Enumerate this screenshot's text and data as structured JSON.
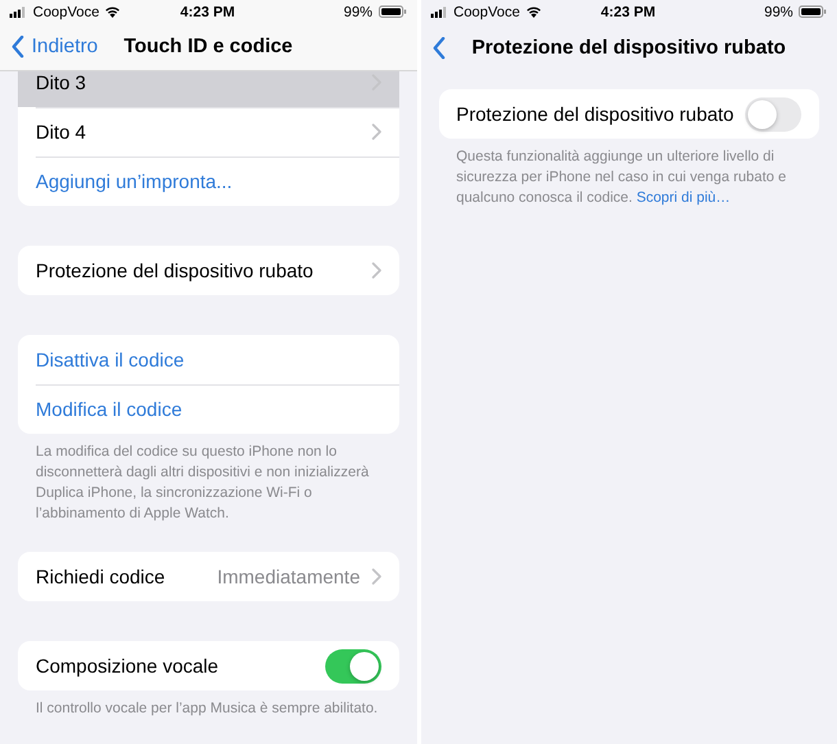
{
  "screens": [
    {
      "status_bar": {
        "carrier": "CoopVoce",
        "time": "4:23 PM",
        "battery": "99%"
      },
      "nav": {
        "back_label": "Indietro",
        "title": "Touch ID e codice",
        "scrolled": true
      },
      "sections": [
        {
          "rows": [
            {
              "kind": "nav",
              "label": "Dito 3",
              "selected": true
            },
            {
              "kind": "nav",
              "label": "Dito 4",
              "selected": false
            },
            {
              "kind": "link",
              "label": "Aggiungi un’impronta..."
            }
          ]
        },
        {
          "rows": [
            {
              "kind": "nav",
              "label": "Protezione del dispositivo rubato",
              "selected": false
            }
          ]
        },
        {
          "rows": [
            {
              "kind": "link",
              "label": "Disattiva il codice"
            },
            {
              "kind": "link",
              "label": "Modifica il codice"
            }
          ],
          "footer": "La modifica del codice su questo iPhone non lo disconnetterà dagli altri dispositivi e non inizializzerà Duplica iPhone, la sincronizzazione Wi-Fi o l’abbinamento di Apple Watch."
        },
        {
          "rows": [
            {
              "kind": "value",
              "label": "Richiedi codice",
              "value": "Immediatamente",
              "selected": false
            }
          ]
        },
        {
          "rows": [
            {
              "kind": "toggle",
              "label": "Composizione vocale",
              "on": true
            }
          ],
          "footer": "Il controllo vocale per l’app Musica è sempre abilitato."
        }
      ]
    },
    {
      "status_bar": {
        "carrier": "CoopVoce",
        "time": "4:23 PM",
        "battery": "99%"
      },
      "nav": {
        "title": "Protezione del dispositivo rubato"
      },
      "sections": [
        {
          "rows": [
            {
              "kind": "toggle",
              "label": "Protezione del dispositivo rubato",
              "on": false
            }
          ],
          "footer": "Questa funzionalità aggiunge un ulteriore livello di sicurezza per iPhone nel caso in cui venga rubato e qualcuno conosca il codice.",
          "footer_link": "Scopri di più…"
        }
      ]
    }
  ]
}
